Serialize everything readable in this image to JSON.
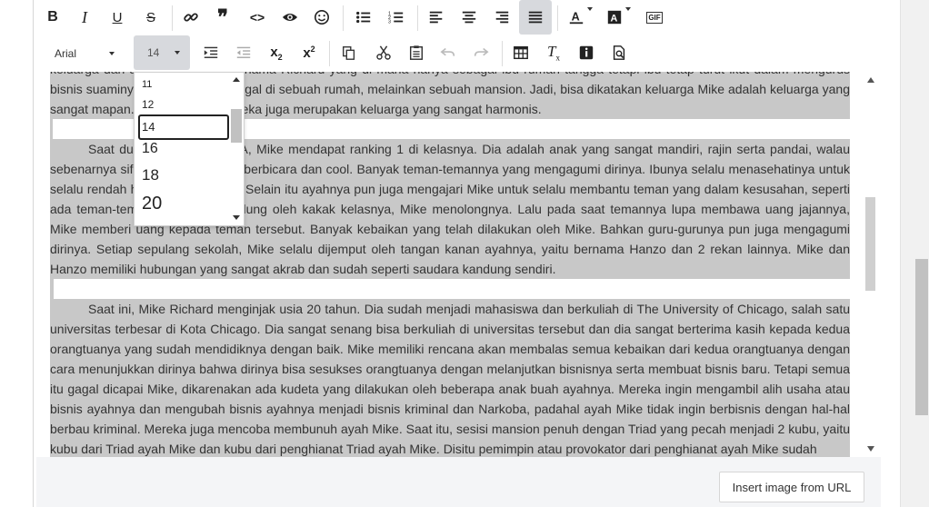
{
  "toolbar": {
    "font_family": "Arial",
    "font_size": "14",
    "gif_label": "GIF"
  },
  "font_size_dropdown": {
    "options": [
      "11",
      "12",
      "14",
      "16",
      "18",
      "20"
    ],
    "selected": "14"
  },
  "content": {
    "paragraphs": [
      {
        "text_top": "keluarga dari ayah Mike yang bernama Richard yang di mana hanya sebagai ibu rumah tangga tetapi ibu tetap turut ikut dalam mengurus bisnis suaminya. Mereka tidak tinggal di sebuah rumah, melainkan sebuah mansion. Jadi, bisa dikatakan keluarga Mike adalah keluarga yang sangat mapan. Tak hanya itu, mereka juga merupakan keluarga yang sangat harmonis."
      },
      {
        "text": "Saat duduk di bangku SMA, Mike mendapat ranking 1 di kelasnya. Dia adalah anak yang sangat mandiri, rajin serta pandai, walau sebenarnya sifatnya tidak banyak berbicara dan cool. Banyak teman-temannya yang mengagumi dirinya. Ibunya selalu menasehatinya untuk selalu rendah hati tidak sombong. Selain itu ayahnya pun juga mengajari Mike untuk selalu membantu teman yang dalam kesusahan, seperti ada teman-temannya yang dirundung oleh kakak kelasnya, Mike menolongnya. Lalu pada saat temannya lupa membawa uang jajannya, Mike memberi uang kepada teman tersebut. Banyak kebaikan yang telah dilakukan oleh Mike. Bahkan guru-gurunya pun juga mengagumi dirinya. Setiap sepulang sekolah, Mike selalu dijemput oleh tangan kanan ayahnya, yaitu bernama Hanzo dan 2 rekan lainnya. Mike dan Hanzo memiliki hubungan yang sangat akrab dan sudah seperti saudara kandung sendiri."
      },
      {
        "text": "Saat ini, Mike Richard menginjak usia 20 tahun. Dia sudah menjadi mahasiswa dan berkuliah di The University of Chicago, salah satu universitas terbesar di Kota Chicago. Dia sangat senang bisa berkuliah di universitas tersebut dan dia sangat berterima kasih kepada kedua orangtuanya yang sudah mendidiknya dengan baik. Mike memiliki rencana akan membalas semua kebaikan dari kedua orangtuanya dengan cara menunjukkan dirinya bahwa dirinya bisa sesukses orangtuanya dengan melanjutkan bisnisnya serta membuat bisnis baru. Tetapi semua itu gagal dicapai Mike, dikarenakan ada kudeta yang dilakukan oleh beberapa anak buah ayahnya. Mereka ingin mengambil alih usaha atau bisnis ayahnya dan mengubah bisnis ayahnya menjadi bisnis kriminal dan Narkoba, padahal ayah Mike tidak ingin berbisnis dengan hal-hal berbau kriminal. Mereka juga mencoba membunuh ayah Mike. Saat itu, sesisi mansion penuh dengan Triad yang pecah menjadi 2 kubu, yaitu kubu dari Triad ayah Mike dan kubu dari penghianat Triad ayah Mike. Disitu pemimpin atau provokator dari penghianat ayah Mike sudah"
      }
    ]
  },
  "insert_image_button": "Insert image from URL"
}
